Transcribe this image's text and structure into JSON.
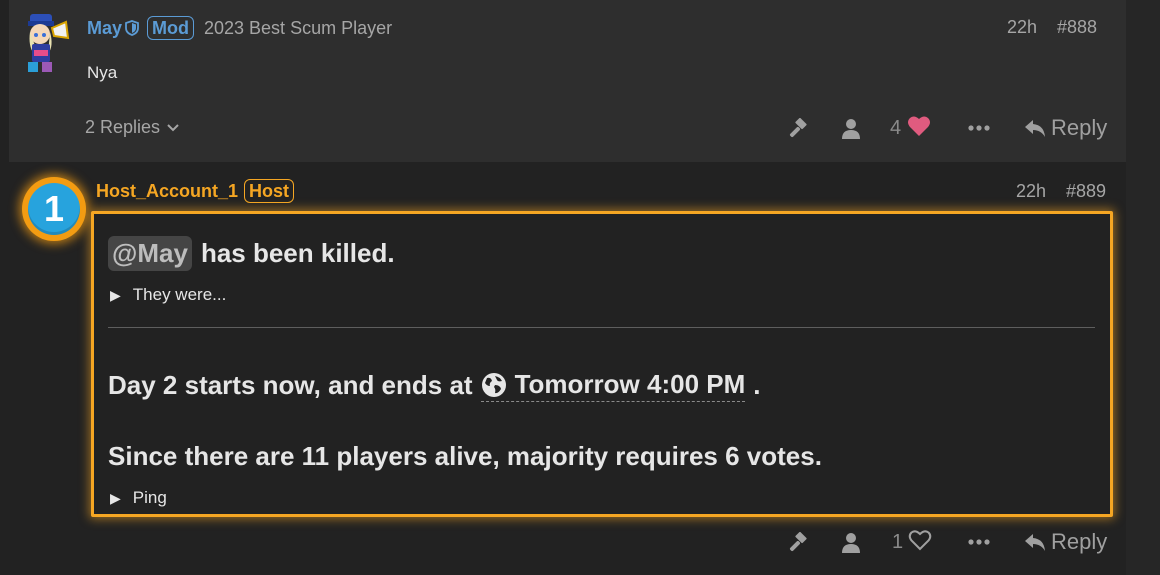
{
  "post888": {
    "username": "May",
    "badge": "Mod",
    "user_title": "2023 Best Scum Player",
    "time": "22h",
    "number": "#888",
    "body": "Nya",
    "replies_label": "2 Replies",
    "like_count": "4",
    "reply_label": "Reply"
  },
  "post889": {
    "marker": "1",
    "username": "Host_Account_1",
    "badge": "Host",
    "time": "22h",
    "number": "#889",
    "mention": "@May",
    "killed_text": "has been killed.",
    "details1": "They were...",
    "day_prefix": "Day 2 starts now, and ends at",
    "date_text": "Tomorrow 4:00 PM",
    "day_suffix": ".",
    "majority_text": "Since there are 11 players alive, majority requires 6 votes.",
    "details2": "Ping",
    "like_count": "1",
    "reply_label": "Reply"
  },
  "colors": {
    "mod_blue": "#5b9bd5",
    "host_orange": "#f5a623",
    "heart_pink": "#e05b7f",
    "marker_blue": "#27a3dd"
  },
  "icons": [
    "shield-icon",
    "chevron-down-icon",
    "hammer-icon",
    "user-icon",
    "heart-icon",
    "heart-outline-icon",
    "more-icon",
    "reply-icon",
    "globe-icon",
    "triangle-right-icon"
  ]
}
